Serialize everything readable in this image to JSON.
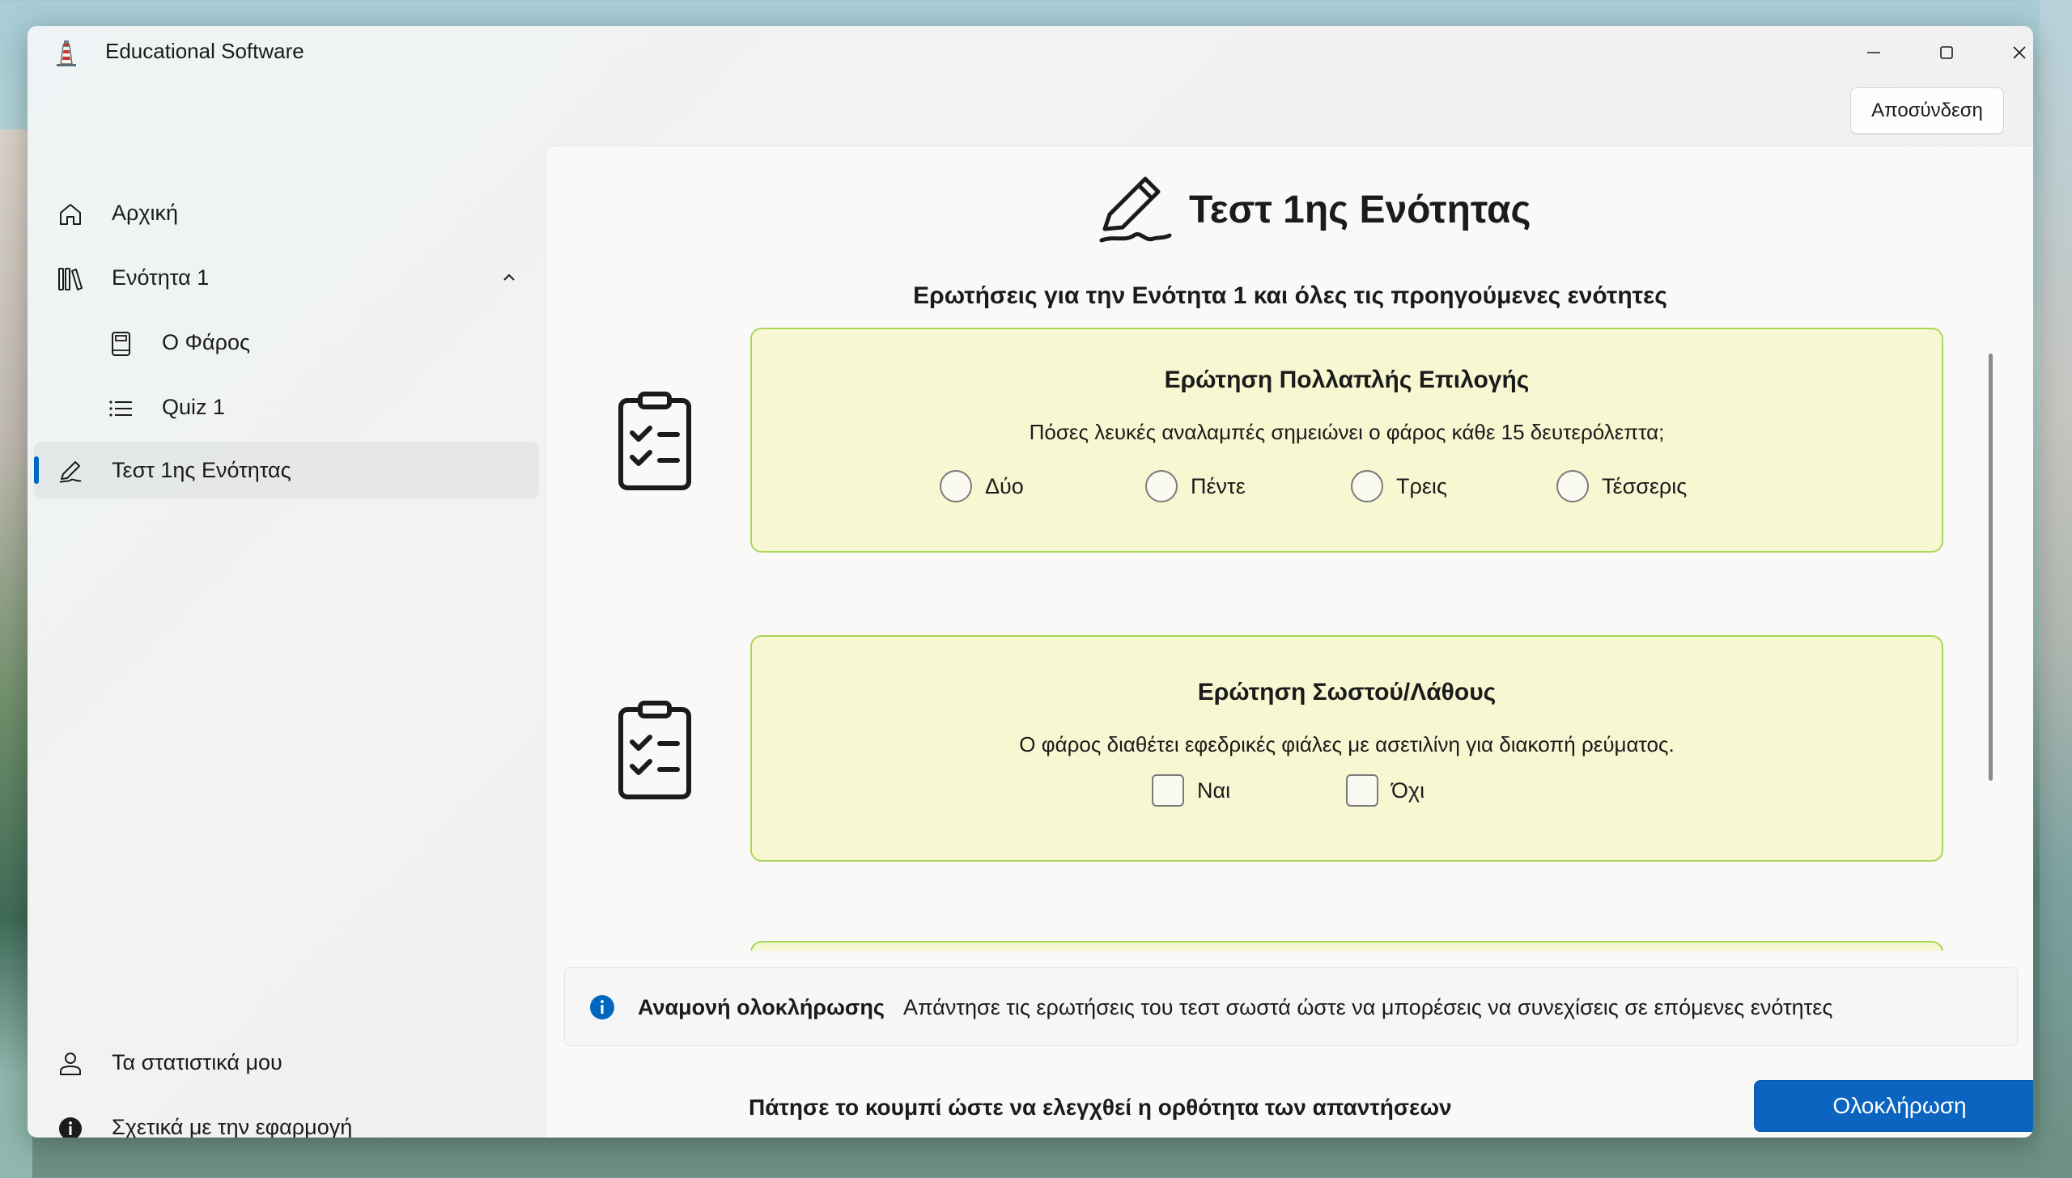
{
  "window": {
    "title": "Educational Software",
    "app_icon": "lighthouse-icon"
  },
  "header": {
    "logout_label": "Αποσύνδεση"
  },
  "sidebar": {
    "items": [
      {
        "label": "Αρχική",
        "icon": "home-icon"
      },
      {
        "label": "Ενότητα 1",
        "icon": "library-icon",
        "expanded": true
      },
      {
        "label": "Ο Φάρος",
        "icon": "book-icon"
      },
      {
        "label": "Quiz 1",
        "icon": "list-icon"
      },
      {
        "label": "Τεστ 1ης Ενότητας",
        "icon": "signature-icon",
        "selected": true
      }
    ],
    "footer_items": [
      {
        "label": "Τα στατιστικά μου",
        "icon": "person-icon"
      },
      {
        "label": "Σχετικά με την εφαρμογή",
        "icon": "info-icon"
      }
    ]
  },
  "main": {
    "title": "Τεστ 1ης Ενότητας",
    "subtitle": "Ερωτήσεις για την Ενότητα 1 και όλες τις προηγούμενες ενότητες",
    "questions": [
      {
        "title": "Ερώτηση Πολλαπλής Επιλογής",
        "text": "Πόσες λευκές αναλαμπές σημειώνει ο φάρος κάθε 15 δευτερόλεπτα;",
        "type": "radio",
        "options": [
          "Δύο",
          "Πέντε",
          "Τρεις",
          "Τέσσερις"
        ]
      },
      {
        "title": "Ερώτηση Σωστού/Λάθους",
        "text": "Ο φάρος διαθέτει εφεδρικές φιάλες με ασετιλίνη για διακοπή ρεύματος.",
        "type": "checkbox",
        "options": [
          "Ναι",
          "Όχι"
        ]
      }
    ],
    "info": {
      "title": "Αναμονή ολοκλήρωσης",
      "message": "Απάντησε τις ερωτήσεις του τεστ σωστά ώστε να μπορέσεις να συνεχίσεις σε επόμενες ενότητες"
    },
    "footer": {
      "hint": "Πάτησε το κουμπί ώστε να ελεγχθεί η ορθότητα των απαντήσεων",
      "button_label": "Ολοκλήρωση"
    }
  },
  "colors": {
    "accent": "#0a64c0",
    "card_background": "#f7f8d2",
    "card_border": "#a9d65a",
    "info": "#0067c0"
  }
}
